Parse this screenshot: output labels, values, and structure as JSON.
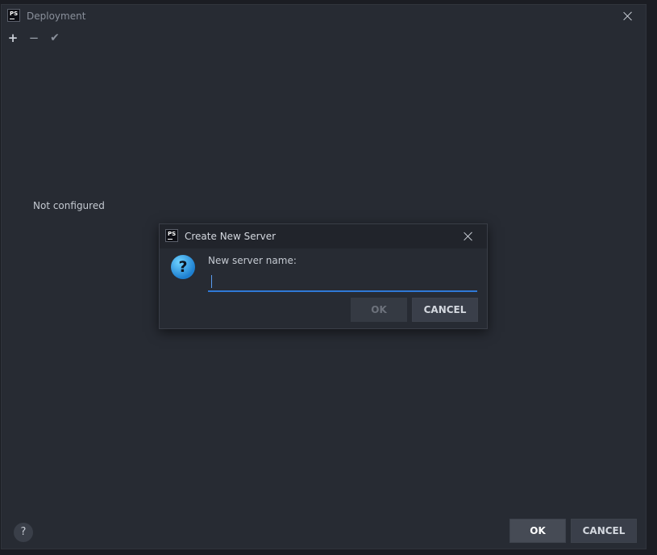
{
  "window": {
    "title": "Deployment",
    "logo_text": "PS",
    "close_label": "Close"
  },
  "toolbar": {
    "add_glyph": "+",
    "remove_glyph": "−",
    "apply_glyph": "✔"
  },
  "main": {
    "empty_state": "Not configured"
  },
  "footer": {
    "help_glyph": "?",
    "ok_label": "OK",
    "cancel_label": "CANCEL"
  },
  "dialog": {
    "title": "Create New Server",
    "logo_text": "PS",
    "question_glyph": "?",
    "field_label": "New server name:",
    "input_value": "",
    "ok_label": "OK",
    "cancel_label": "CANCEL"
  },
  "icons": {
    "app": "phpstorm-logo-icon",
    "close": "close-icon",
    "add": "plus-icon",
    "remove": "minus-icon",
    "apply": "checkmark-icon",
    "help": "help-icon",
    "question": "question-icon"
  },
  "colors": {
    "background": "#272b33",
    "accent": "#2f78d6"
  }
}
